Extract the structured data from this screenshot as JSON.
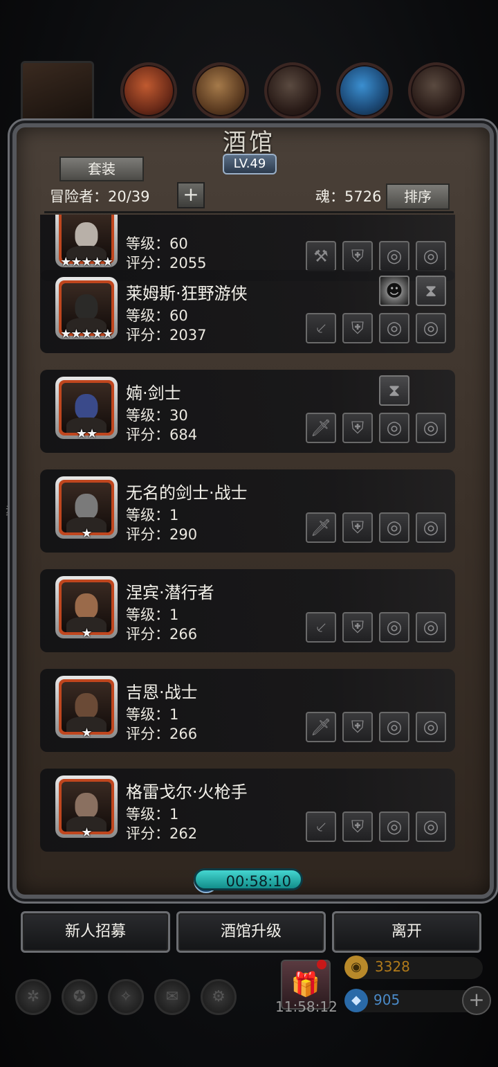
{
  "panel": {
    "title": "酒馆",
    "level": "LV.49",
    "set_button": "套装",
    "adventurers_label": "冒险者：20/39",
    "add_label": "+",
    "soul_label": "魂：5726",
    "sort_button": "排序"
  },
  "heroes": [
    {
      "name": "",
      "level": "等级：60",
      "score": "评分：2055",
      "stars": "★★★★★",
      "face": "#b8b0a8",
      "equips": [
        "hammer-icon",
        "armor-icon",
        "ring-icon",
        "ring-icon"
      ],
      "relics": []
    },
    {
      "name": "莱姆斯·狂野游侠",
      "level": "等级：60",
      "score": "评分：2037",
      "stars": "★★★★★",
      "face": "#2b2a28",
      "equips": [
        "blade-icon",
        "armor-icon",
        "ring-icon",
        "ring-icon"
      ],
      "relics": [
        "mask-icon",
        "hourglass-icon"
      ]
    },
    {
      "name": "婻·剑士",
      "level": "等级：30",
      "score": "评分：684",
      "stars": "★★",
      "face": "#3a4a8a",
      "equips": [
        "sword-icon",
        "armor-icon",
        "ring-icon",
        "ring-icon"
      ],
      "relics": [
        "hourglass-icon"
      ]
    },
    {
      "name": "无名的剑士·战士",
      "level": "等级：1",
      "score": "评分：290",
      "stars": "★",
      "face": "#7a7a7a",
      "equips": [
        "sword-icon",
        "armor-icon",
        "ring-icon",
        "ring-icon"
      ],
      "relics": []
    },
    {
      "name": "涅宾·潜行者",
      "level": "等级：1",
      "score": "评分：266",
      "stars": "★",
      "face": "#9a6a4a",
      "equips": [
        "blade-icon",
        "armor-icon",
        "ring-icon",
        "ring-icon"
      ],
      "relics": []
    },
    {
      "name": "吉恩·战士",
      "level": "等级：1",
      "score": "评分：266",
      "stars": "★",
      "face": "#6a4a36",
      "equips": [
        "sword-icon",
        "armor-icon",
        "ring-icon",
        "ring-icon"
      ],
      "relics": []
    },
    {
      "name": "格雷戈尔·火枪手",
      "level": "等级：1",
      "score": "评分：262",
      "stars": "★",
      "face": "#8a7060",
      "equips": [
        "blade-icon",
        "armor-icon",
        "ring-icon",
        "ring-icon"
      ],
      "relics": []
    }
  ],
  "timer": "00:58:10",
  "buttons": {
    "recruit": "新人招募",
    "upgrade": "酒馆升级",
    "leave": "离开"
  },
  "background": {
    "gift_timer": "11:58:12",
    "gold": "3328",
    "gems": "905",
    "side_char": "教"
  }
}
